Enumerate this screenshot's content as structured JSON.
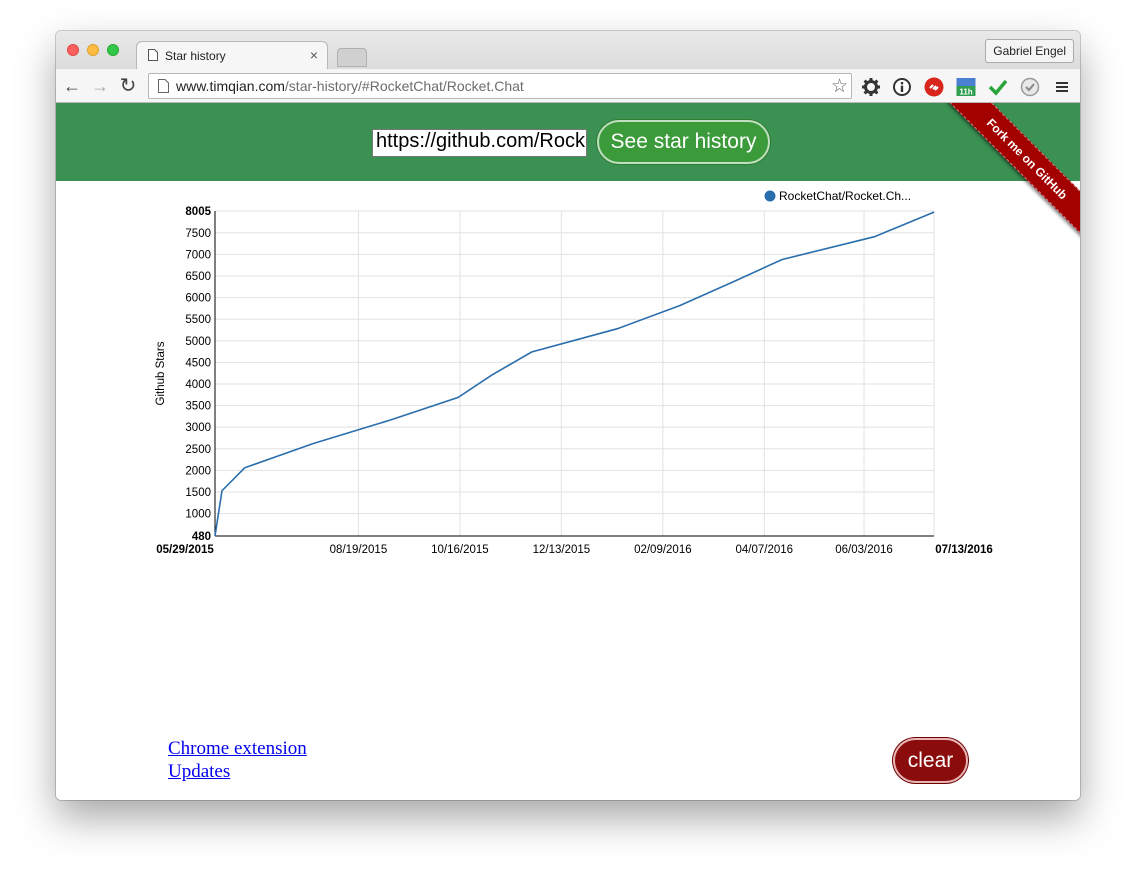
{
  "browser": {
    "tab_title": "Star history",
    "tab_close": "×",
    "profile_name": "Gabriel Engel",
    "url_host": "www.timqian.com",
    "url_path": "/star-history/#RocketChat/Rocket.Chat",
    "nav": {
      "back": "←",
      "forward": "→",
      "reload": "↻"
    },
    "star_icon": "☆",
    "menu_icon": "≡",
    "extensions": [
      "gear-icon",
      "info-icon",
      "adblock-icon",
      "calendar-icon",
      "checkmark-icon",
      "badge-icon",
      "menu-icon"
    ],
    "calendar_badge": "11h"
  },
  "page": {
    "repo_input_value": "https://github.com/RocketChat/Rocket.Chat",
    "see_button": "See star history",
    "ribbon": "Fork me on GitHub",
    "links": [
      "Chrome extension",
      "Updates"
    ],
    "clear_button": "clear",
    "colors": {
      "header": "#3a9152",
      "see_button": "#3b9a3a",
      "ribbon": "#a30000",
      "clear_button": "#8b0c0c",
      "series": "#2a6ead"
    }
  },
  "chart_data": {
    "type": "line",
    "ylabel": "Github Stars",
    "xlabel": "",
    "legend_position": "top-right",
    "grid": true,
    "series": [
      {
        "name": "RocketChat/Rocket.Ch...",
        "points": [
          {
            "x": "2015-05-29",
            "y": 480
          },
          {
            "x": "2015-06-02",
            "y": 1530
          },
          {
            "x": "2015-06-15",
            "y": 2060
          },
          {
            "x": "2015-07-24",
            "y": 2620
          },
          {
            "x": "2015-09-05",
            "y": 3150
          },
          {
            "x": "2015-10-15",
            "y": 3690
          },
          {
            "x": "2015-11-03",
            "y": 4200
          },
          {
            "x": "2015-11-26",
            "y": 4740
          },
          {
            "x": "2016-01-14",
            "y": 5280
          },
          {
            "x": "2016-02-19",
            "y": 5820
          },
          {
            "x": "2016-03-20",
            "y": 6360
          },
          {
            "x": "2016-04-17",
            "y": 6880
          },
          {
            "x": "2016-06-09",
            "y": 7410
          },
          {
            "x": "2016-07-13",
            "y": 7980
          }
        ]
      }
    ],
    "x_ticks": [
      "05/29/2015",
      "08/19/2015",
      "10/16/2015",
      "12/13/2015",
      "02/09/2016",
      "04/07/2016",
      "06/03/2016",
      "07/13/2016"
    ],
    "y_ticks": [
      480,
      1000,
      1500,
      2000,
      2500,
      3000,
      3500,
      4000,
      4500,
      5000,
      5500,
      6000,
      6500,
      7000,
      7500,
      8005
    ],
    "ylim": [
      480,
      8005
    ],
    "xlim": [
      "2015-05-29",
      "2016-07-13"
    ]
  }
}
